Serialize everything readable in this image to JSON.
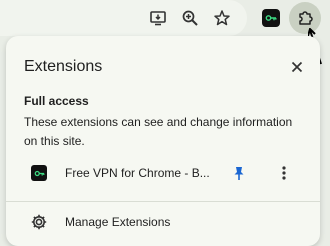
{
  "toolbar": {
    "icons": [
      "install-app-icon",
      "zoom-icon",
      "bookmark-star-icon",
      "vpn-extension-icon",
      "extensions-puzzle-icon"
    ]
  },
  "panel": {
    "title": "Extensions",
    "close_icon": "close-icon",
    "section": {
      "title": "Full access",
      "description": "These extensions can see and change information on this site."
    },
    "extensions": [
      {
        "name": "Free VPN for Chrome - B...",
        "icon": "vpn-key-icon",
        "pinned": true
      }
    ],
    "manage_label": "Manage Extensions"
  },
  "colors": {
    "background": "#e9ede6",
    "panel": "#f6f8f2",
    "pin": "#1a66d2",
    "text": "#1f1f1f"
  }
}
